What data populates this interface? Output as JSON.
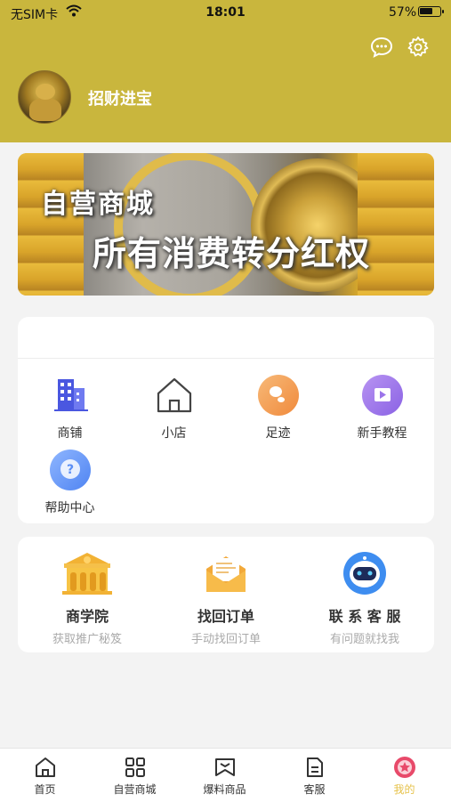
{
  "status_bar": {
    "carrier": "无SIM卡",
    "time": "18:01",
    "battery": "57%",
    "battery_level": 0.57
  },
  "header": {
    "icons": [
      "chat-icon",
      "gear-icon"
    ],
    "avatar": "golden-buddha-avatar",
    "username": "招财进宝",
    "background_color": "#c9b63d"
  },
  "banner": {
    "line1": "自营商城",
    "line2": "所有消费转分红权"
  },
  "menu": {
    "items": [
      {
        "label": "商铺",
        "icon": "building-icon"
      },
      {
        "label": "小店",
        "icon": "house-icon"
      },
      {
        "label": "足迹",
        "icon": "footprint-icon"
      },
      {
        "label": "新手教程",
        "icon": "video-icon"
      },
      {
        "label": "帮助中心",
        "icon": "help-icon"
      }
    ]
  },
  "services": [
    {
      "title": "商学院",
      "subtitle": "获取推广秘笈",
      "icon": "academy-icon"
    },
    {
      "title": "找回订单",
      "subtitle": "手动找回订单",
      "icon": "envelope-icon"
    },
    {
      "title": "联 系 客 服",
      "subtitle": "有问题就找我",
      "icon": "robot-icon"
    }
  ],
  "tabbar": {
    "items": [
      {
        "label": "首页",
        "icon": "home-icon"
      },
      {
        "label": "自营商城",
        "icon": "grid-icon"
      },
      {
        "label": "爆料商品",
        "icon": "bookmark-icon"
      },
      {
        "label": "客服",
        "icon": "document-icon"
      },
      {
        "label": "我的",
        "icon": "star-badge-icon"
      }
    ],
    "active_index": 4,
    "active_color": "#e6c24a"
  }
}
